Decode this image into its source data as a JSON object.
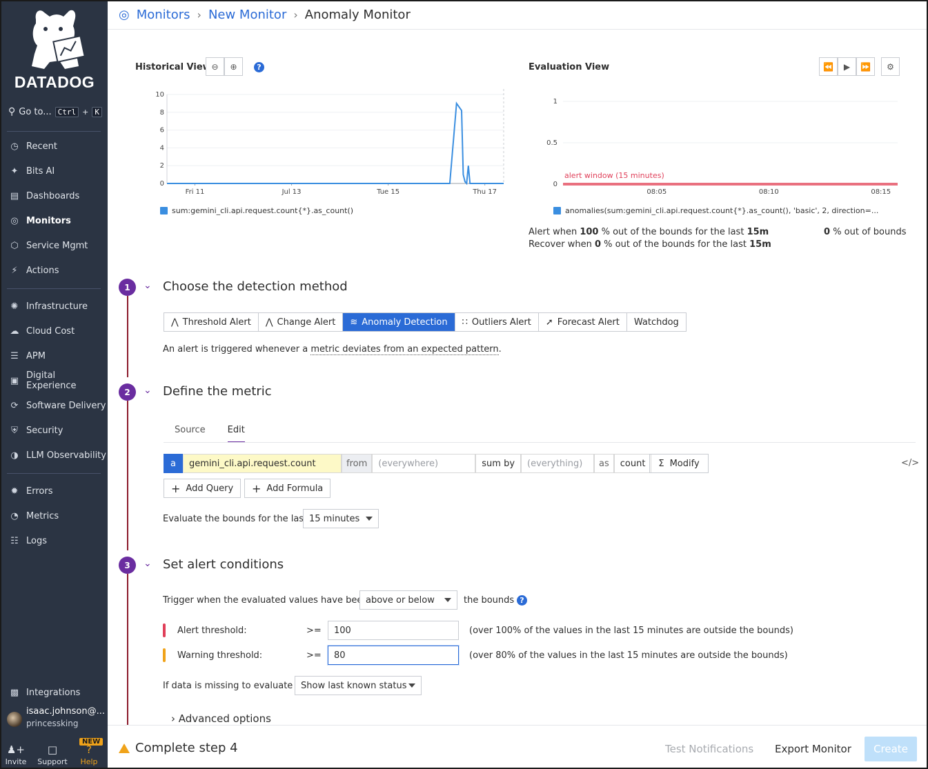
{
  "sidebar": {
    "brand": "DATADOG",
    "goto_label": "Go to...",
    "goto_kbd1": "Ctrl",
    "goto_plus": "+",
    "goto_kbd2": "K",
    "items": [
      {
        "label": "Recent",
        "icon": "clock-icon"
      },
      {
        "label": "Bits AI",
        "icon": "sparkle-icon"
      },
      {
        "label": "Dashboards",
        "icon": "dashboard-icon"
      },
      {
        "label": "Monitors",
        "icon": "monitor-icon",
        "active": true
      },
      {
        "label": "Service Mgmt",
        "icon": "service-icon"
      },
      {
        "label": "Actions",
        "icon": "bolt-icon"
      },
      {
        "label": "Infrastructure",
        "icon": "infra-icon"
      },
      {
        "label": "Cloud Cost",
        "icon": "cloud-cost-icon"
      },
      {
        "label": "APM",
        "icon": "apm-icon"
      },
      {
        "label": "Digital Experience",
        "icon": "dx-icon"
      },
      {
        "label": "Software Delivery",
        "icon": "delivery-icon"
      },
      {
        "label": "Security",
        "icon": "shield-icon"
      },
      {
        "label": "LLM Observability",
        "icon": "llm-icon"
      },
      {
        "label": "Errors",
        "icon": "bug-icon"
      },
      {
        "label": "Metrics",
        "icon": "gauge-icon"
      },
      {
        "label": "Logs",
        "icon": "logs-icon"
      },
      {
        "label": "Integrations",
        "icon": "puzzle-icon"
      }
    ],
    "user": {
      "name": "isaac.johnson@...",
      "org": "princessking"
    },
    "bottom": {
      "invite": "Invite",
      "support": "Support",
      "help": "Help",
      "new_badge": "NEW"
    }
  },
  "breadcrumb": {
    "root": "Monitors",
    "mid": "New Monitor",
    "current": "Anomaly Monitor"
  },
  "historical": {
    "title": "Historical View",
    "help": "?",
    "legend": "sum:gemini_cli.api.request.count{*}.as_count()"
  },
  "evaluation": {
    "title": "Evaluation View",
    "alert_window": "alert window (15 minutes)",
    "legend": "anomalies(sum:gemini_cli.api.request.count{*}.as_count(), 'basic', 2, direction=...",
    "alert_prefix": "Alert when",
    "alert_pct": "100",
    "alert_mid": "% out of the bounds for the last",
    "alert_window_val": "15m",
    "recover_prefix": "Recover when",
    "recover_pct": "0",
    "recover_mid": "% out of the bounds for the last",
    "recover_window_val": "15m",
    "out_pct": "0",
    "out_label": "% out of bounds"
  },
  "chart_data": [
    {
      "type": "line",
      "title": "Historical View",
      "x_ticks": [
        "Fri 11",
        "Jul 13",
        "Tue 15",
        "Thu 17"
      ],
      "y_ticks": [
        0,
        2,
        4,
        6,
        8,
        10
      ],
      "ylim": [
        0,
        10
      ],
      "series": [
        {
          "name": "sum:gemini_cli.api.request.count{*}.as_count()",
          "x": [
            0,
            0.84,
            0.86,
            0.875,
            0.88,
            0.885,
            0.89,
            0.895,
            0.9,
            0.905,
            0.91,
            1.0
          ],
          "values": [
            0,
            0,
            9.0,
            8.2,
            1.0,
            0.2,
            0,
            2.0,
            0,
            0,
            0,
            0
          ]
        }
      ]
    },
    {
      "type": "line",
      "title": "Evaluation View",
      "x_ticks": [
        "08:05",
        "08:10",
        "08:15"
      ],
      "y_ticks": [
        0,
        0.5,
        1
      ],
      "ylim": [
        0,
        1
      ],
      "series": [
        {
          "name": "anomalies(sum:gemini_cli.api.request.count{*}.as_count(), 'basic', 2, direction=...",
          "values": [
            0,
            0,
            0,
            0
          ]
        }
      ]
    }
  ],
  "step1": {
    "num": "1",
    "title": "Choose the detection method",
    "methods": [
      "Threshold Alert",
      "Change Alert",
      "Anomaly Detection",
      "Outliers Alert",
      "Forecast Alert",
      "Watchdog"
    ],
    "desc_prefix": "An alert is triggered whenever a",
    "desc_link": "metric deviates from an expected pattern",
    "desc_suffix": "."
  },
  "step2": {
    "num": "2",
    "title": "Define the metric",
    "tabs": [
      "Source",
      "Edit"
    ],
    "query": {
      "label": "a",
      "metric": "gemini_cli.api.request.count",
      "from_label": "from",
      "from_placeholder": "(everywhere)",
      "sumby_label": "sum by",
      "sumby_placeholder": "(everything)",
      "as_label": "as",
      "as_value": "count",
      "modify": "Modify"
    },
    "add_query": "Add Query",
    "add_formula": "Add Formula",
    "eval_label": "Evaluate the bounds for the last",
    "eval_value": "15 minutes"
  },
  "step3": {
    "num": "3",
    "title": "Set alert conditions",
    "trigger_label": "Trigger when the evaluated values have been",
    "trigger_value": "above or below",
    "trigger_suffix": "the bounds",
    "alert_label": "Alert threshold:",
    "alert_op": ">=",
    "alert_value": "100",
    "alert_note": "(over 100% of the values in the last 15 minutes are outside the bounds)",
    "warn_label": "Warning threshold:",
    "warn_op": ">=",
    "warn_value": "80",
    "warn_note": "(over 80% of the values in the last 15 minutes are outside the bounds)",
    "missing_label": "If data is missing to evaluate",
    "missing_value": "Show last known status",
    "advanced": "Advanced options"
  },
  "footer": {
    "warn": "Complete step 4",
    "test": "Test Notifications",
    "export": "Export Monitor",
    "create": "Create"
  },
  "colors": {
    "sidebar": "#2b3443",
    "accent": "#2b6bd6",
    "step": "#6a2da0",
    "alert": "#e0405a",
    "warn": "#f0a31a",
    "series": "#3a8ee0"
  }
}
